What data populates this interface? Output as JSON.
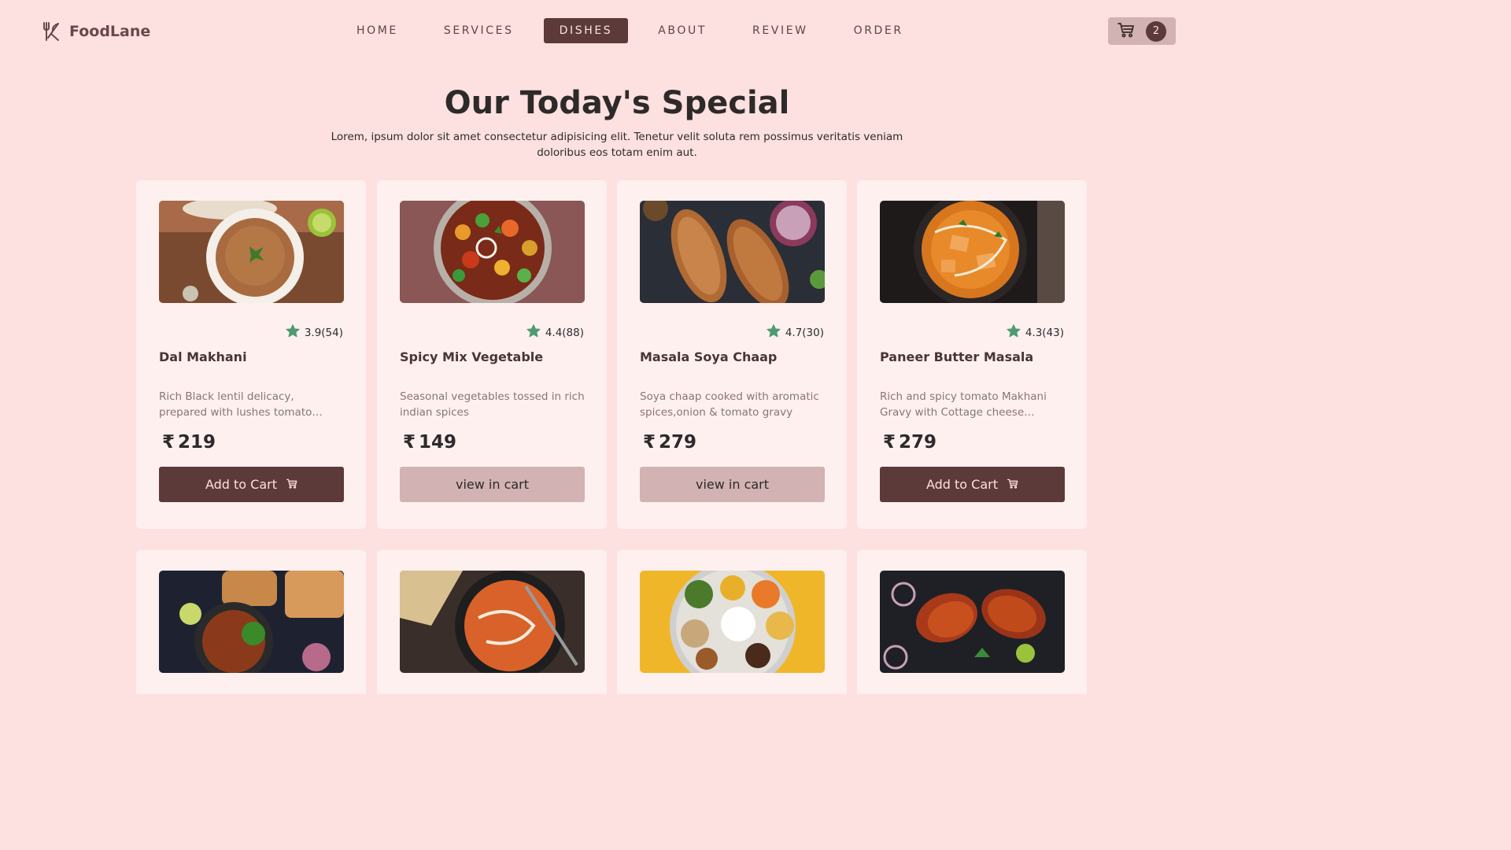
{
  "brand": {
    "name": "FoodLane"
  },
  "nav": {
    "items": [
      {
        "label": "HOME"
      },
      {
        "label": "SERVICES"
      },
      {
        "label": "DISHES",
        "active": true
      },
      {
        "label": "ABOUT"
      },
      {
        "label": "REVIEW"
      },
      {
        "label": "ORDER"
      }
    ]
  },
  "cart": {
    "count": "2",
    "icon": "cart-icon"
  },
  "section": {
    "title": "Our Today's Special",
    "description": "Lorem, ipsum dolor sit amet consectetur adipisicing elit. Tenetur velit soluta rem possimus veritatis veniam doloribus eos totam enim aut."
  },
  "currency_symbol": "₹",
  "dishes": [
    {
      "name": "Dal Makhani",
      "rating": "3.9(54)",
      "description": "Rich Black lentil delicacy, prepared with lushes tomato gravy, cream and butter.",
      "price": "219",
      "button": "Add to Cart",
      "in_cart": false
    },
    {
      "name": "Spicy Mix Vegetable",
      "rating": "4.4(88)",
      "description": "Seasonal vegetables tossed in rich indian spices",
      "price": "149",
      "button": "view in cart",
      "in_cart": true
    },
    {
      "name": "Masala Soya Chaap",
      "rating": "4.7(30)",
      "description": "Soya chaap cooked with aromatic spices,onion & tomato gravy",
      "price": "279",
      "button": "view in cart",
      "in_cart": true
    },
    {
      "name": "Paneer Butter Masala",
      "rating": "4.3(43)",
      "description": "Rich and spicy tomato Makhani Gravy with Cottage cheese finished with cream.",
      "price": "279",
      "button": "Add to Cart",
      "in_cart": false
    }
  ],
  "colors": {
    "background": "#fde0e0",
    "card": "#fff0f0",
    "accent": "#5d3a3a",
    "muted_button": "#d2b2b2",
    "star": "#4f9a72"
  }
}
